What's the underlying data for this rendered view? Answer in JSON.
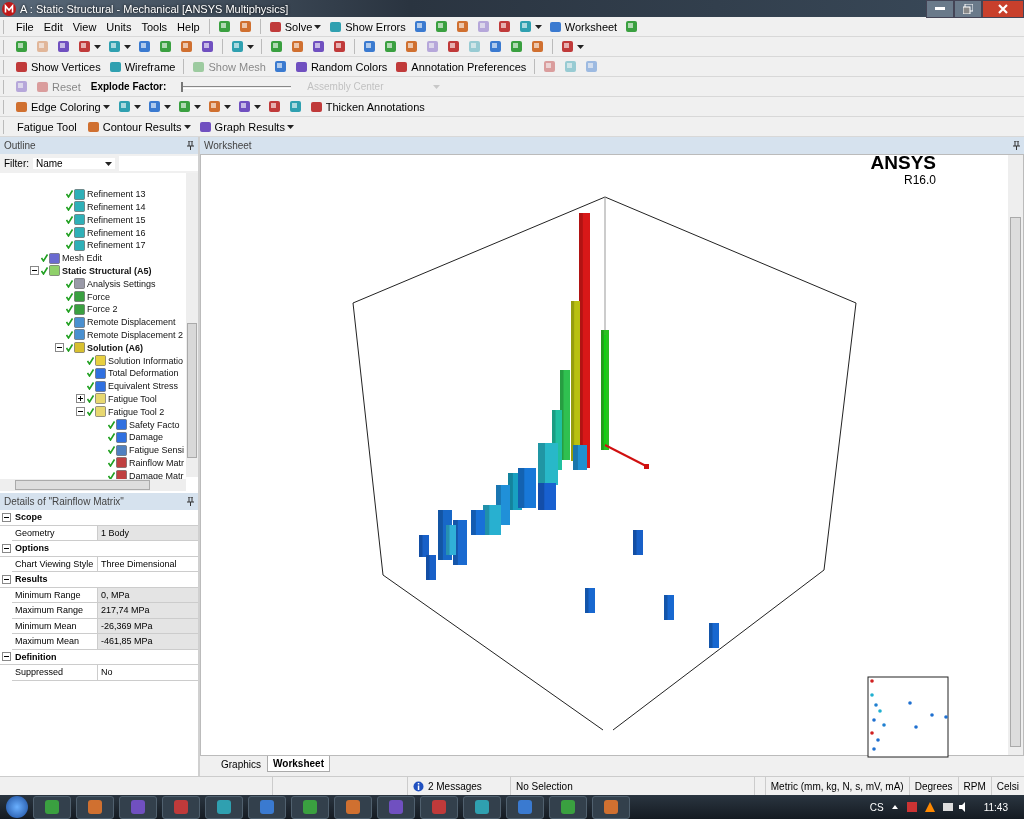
{
  "window": {
    "title": "A : Static Structural - Mechanical [ANSYS Multiphysics]"
  },
  "menu": [
    "File",
    "Edit",
    "View",
    "Units",
    "Tools",
    "Help"
  ],
  "toolbars": [
    [
      {
        "kind": "sep"
      },
      {
        "kind": "icon",
        "disabled": false,
        "dropdown": false
      },
      {
        "kind": "icon",
        "disabled": false,
        "dropdown": false
      },
      {
        "kind": "sep"
      },
      {
        "kind": "button",
        "label": "Solve",
        "disabled": false,
        "dropdown": true
      },
      {
        "kind": "button",
        "label": "Show Errors",
        "disabled": false,
        "dropdown": false
      },
      {
        "kind": "icon",
        "disabled": false,
        "dropdown": false
      },
      {
        "kind": "icon",
        "disabled": false,
        "dropdown": false
      },
      {
        "kind": "icon",
        "disabled": false,
        "dropdown": false
      },
      {
        "kind": "icon",
        "disabled": true,
        "dropdown": false
      },
      {
        "kind": "icon",
        "disabled": false,
        "dropdown": false
      },
      {
        "kind": "icon",
        "disabled": false,
        "dropdown": true
      },
      {
        "kind": "button",
        "label": "Worksheet",
        "disabled": false,
        "dropdown": false
      },
      {
        "kind": "icon",
        "disabled": false,
        "dropdown": false
      }
    ],
    [
      {
        "kind": "icon",
        "disabled": false,
        "dropdown": false
      },
      {
        "kind": "icon",
        "disabled": true,
        "dropdown": false
      },
      {
        "kind": "icon",
        "disabled": false,
        "dropdown": false
      },
      {
        "kind": "icon",
        "disabled": false,
        "dropdown": true
      },
      {
        "kind": "icon",
        "disabled": false,
        "dropdown": true
      },
      {
        "kind": "icon",
        "disabled": false,
        "dropdown": false
      },
      {
        "kind": "icon",
        "disabled": false,
        "dropdown": false
      },
      {
        "kind": "icon",
        "disabled": false,
        "dropdown": false
      },
      {
        "kind": "icon",
        "disabled": false,
        "dropdown": false
      },
      {
        "kind": "sep"
      },
      {
        "kind": "icon",
        "disabled": false,
        "dropdown": true
      },
      {
        "kind": "sep"
      },
      {
        "kind": "icon",
        "disabled": false,
        "dropdown": false
      },
      {
        "kind": "icon",
        "disabled": false,
        "dropdown": false
      },
      {
        "kind": "icon",
        "disabled": false,
        "dropdown": false
      },
      {
        "kind": "icon",
        "disabled": false,
        "dropdown": false
      },
      {
        "kind": "sep"
      },
      {
        "kind": "icon",
        "disabled": false,
        "dropdown": false
      },
      {
        "kind": "icon",
        "disabled": false,
        "dropdown": false
      },
      {
        "kind": "icon",
        "disabled": false,
        "dropdown": false
      },
      {
        "kind": "icon",
        "disabled": true,
        "dropdown": false
      },
      {
        "kind": "icon",
        "disabled": false,
        "dropdown": false
      },
      {
        "kind": "icon",
        "disabled": true,
        "dropdown": false
      },
      {
        "kind": "icon",
        "disabled": false,
        "dropdown": false
      },
      {
        "kind": "icon",
        "disabled": false,
        "dropdown": false
      },
      {
        "kind": "icon",
        "disabled": false,
        "dropdown": false
      },
      {
        "kind": "sep"
      },
      {
        "kind": "icon",
        "disabled": false,
        "dropdown": true
      }
    ],
    [
      {
        "kind": "button",
        "label": "Show Vertices",
        "disabled": false,
        "dropdown": false
      },
      {
        "kind": "button",
        "label": "Wireframe",
        "disabled": false,
        "dropdown": false
      },
      {
        "kind": "sep"
      },
      {
        "kind": "button",
        "label": "Show Mesh",
        "disabled": true,
        "dropdown": false
      },
      {
        "kind": "icon",
        "disabled": false,
        "dropdown": false
      },
      {
        "kind": "button",
        "label": "Random Colors",
        "disabled": false,
        "dropdown": false
      },
      {
        "kind": "button",
        "label": "Annotation Preferences",
        "disabled": false,
        "dropdown": false
      },
      {
        "kind": "sep"
      },
      {
        "kind": "icon",
        "disabled": true,
        "dropdown": false
      },
      {
        "kind": "icon",
        "disabled": true,
        "dropdown": false
      },
      {
        "kind": "icon",
        "disabled": true,
        "dropdown": false
      }
    ],
    [
      {
        "kind": "icon",
        "disabled": true,
        "dropdown": false
      },
      {
        "kind": "button",
        "label": "Reset",
        "disabled": true,
        "dropdown": false
      },
      {
        "kind": "label",
        "label": "Explode Factor:"
      },
      {
        "kind": "slider",
        "level": 0
      },
      {
        "kind": "combo",
        "label": "Assembly Center",
        "disabled": true,
        "dropdown": true
      }
    ],
    [
      {
        "kind": "button",
        "label": "Edge Coloring",
        "disabled": false,
        "dropdown": true
      },
      {
        "kind": "icon",
        "disabled": false,
        "dropdown": true
      },
      {
        "kind": "icon",
        "disabled": false,
        "dropdown": true
      },
      {
        "kind": "icon",
        "disabled": false,
        "dropdown": true
      },
      {
        "kind": "icon",
        "disabled": false,
        "dropdown": true
      },
      {
        "kind": "icon",
        "disabled": false,
        "dropdown": true
      },
      {
        "kind": "icon",
        "disabled": false,
        "dropdown": false
      },
      {
        "kind": "icon",
        "disabled": false,
        "dropdown": false
      },
      {
        "kind": "button",
        "label": "Thicken Annotations",
        "disabled": false,
        "dropdown": false
      }
    ],
    [
      {
        "kind": "label",
        "label": "Fatigue Tool"
      },
      {
        "kind": "button",
        "label": "Contour Results",
        "disabled": false,
        "dropdown": true
      },
      {
        "kind": "button",
        "label": "Graph Results",
        "disabled": false,
        "dropdown": true
      }
    ]
  ],
  "outline": {
    "title": "Outline",
    "filter_label": "Filter:",
    "filter_value": "Name",
    "items": [
      {
        "children": [
          {
            "label": "Refinement 13",
            "kind": "refinement",
            "solved": true
          },
          {
            "label": "Refinement 14",
            "kind": "refinement",
            "solved": true
          },
          {
            "label": "Refinement 15",
            "kind": "refinement",
            "solved": true
          },
          {
            "label": "Refinement 16",
            "kind": "refinement",
            "solved": true
          },
          {
            "label": "Refinement 17",
            "kind": "refinement",
            "solved": true
          }
        ]
      },
      {
        "label": "Mesh Edit",
        "kind": "mesh",
        "solved": true
      },
      {
        "label": "Static Structural (A5)",
        "kind": "analysis",
        "solved": true,
        "expanded": true,
        "children": [
          {
            "label": "Analysis Settings",
            "kind": "settings",
            "solved": true
          },
          {
            "label": "Force",
            "kind": "load",
            "solved": true
          },
          {
            "label": "Force 2",
            "kind": "load",
            "solved": true
          },
          {
            "label": "Remote Displacement",
            "kind": "support",
            "solved": true
          },
          {
            "label": "Remote Displacement 2",
            "kind": "support",
            "solved": true
          },
          {
            "label": "Solution (A6)",
            "kind": "solution",
            "solved": true,
            "expanded": true,
            "children": [
              {
                "label": "Solution Informatio",
                "kind": "info",
                "solved": true
              },
              {
                "label": "Total Deformation",
                "kind": "result",
                "solved": true
              },
              {
                "label": "Equivalent Stress",
                "kind": "result",
                "solved": true
              },
              {
                "label": "Fatigue Tool",
                "kind": "tool",
                "solved": true,
                "expanded": false
              },
              {
                "label": "Fatigue Tool 2",
                "kind": "tool",
                "solved": true,
                "expanded": true,
                "children": [
                  {
                    "label": "Safety Facto",
                    "kind": "result",
                    "solved": true
                  },
                  {
                    "label": "Damage",
                    "kind": "result",
                    "solved": true
                  },
                  {
                    "label": "Fatigue Sensi",
                    "kind": "graph",
                    "solved": true
                  },
                  {
                    "label": "Rainflow Matr",
                    "kind": "matrix",
                    "solved": true
                  },
                  {
                    "label": "Damage Matr",
                    "kind": "matrix",
                    "solved": true
                  }
                ]
              }
            ]
          }
        ]
      }
    ]
  },
  "details": {
    "title": "Details of \"Rainflow Matrix\"",
    "sections": [
      {
        "title": "Scope",
        "expanded": true,
        "rows": [
          {
            "name": "Geometry",
            "value": "1 Body",
            "readonly": true
          }
        ]
      },
      {
        "title": "Options",
        "expanded": true,
        "rows": [
          {
            "name": "Chart Viewing Style",
            "value": "Three Dimensional",
            "readonly": false
          }
        ]
      },
      {
        "title": "Results",
        "expanded": true,
        "rows": [
          {
            "name": "Minimum Range",
            "value": "0, MPa",
            "readonly": true
          },
          {
            "name": "Maximum Range",
            "value": "217,74 MPa",
            "readonly": true
          },
          {
            "name": "Minimum Mean",
            "value": "-26,369 MPa",
            "readonly": true
          },
          {
            "name": "Maximum Mean",
            "value": "-461,85 MPa",
            "readonly": true
          }
        ]
      },
      {
        "title": "Definition",
        "expanded": true,
        "rows": [
          {
            "name": "Suppressed",
            "value": "No",
            "readonly": false
          }
        ]
      }
    ]
  },
  "worksheet": {
    "title": "Worksheet",
    "logo": "ANSYS",
    "version": "R16.0"
  },
  "view_tabs": [
    {
      "label": "Graphics",
      "selected": false
    },
    {
      "label": "Worksheet",
      "selected": true
    }
  ],
  "status_bar": {
    "messages": "2 Messages",
    "selection": "No Selection",
    "units": "Metric (mm, kg, N, s, mV, mA)",
    "angle": "Degrees",
    "speed": "RPM",
    "temperature": "Celsi"
  },
  "taskbar": {
    "language": "CS",
    "time": "11:43"
  }
}
